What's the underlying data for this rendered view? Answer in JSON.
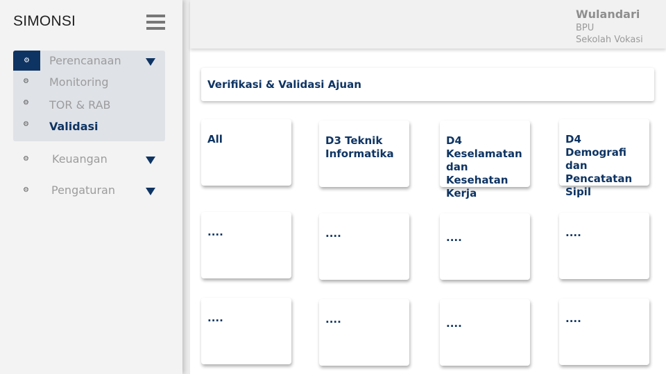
{
  "app": {
    "brand": "SIMONSI"
  },
  "sidebar": {
    "menu": [
      {
        "label": "Perencanaan",
        "icon": "menu-icon",
        "expanded": true,
        "items": [
          {
            "label": "Monitoring"
          },
          {
            "label": "TOR & RAB"
          },
          {
            "label": "Validasi",
            "active": true
          }
        ]
      },
      {
        "label": "Keuangan",
        "icon": "menu-icon",
        "expanded": false
      },
      {
        "label": "Pengaturan",
        "icon": "menu-icon",
        "expanded": false
      }
    ]
  },
  "header": {
    "user_name": "Wulandari",
    "user_role": "BPU",
    "user_unit": "Sekolah Vokasi"
  },
  "main": {
    "title": "Verifikasi & Validasi Ajuan",
    "cards": [
      {
        "label": "All"
      },
      {
        "label": "D3 Teknik Informatika"
      },
      {
        "label": "D4 Keselamatan dan Kesehatan Kerja"
      },
      {
        "label": "D4 Demografi dan Pencatatan Sipil"
      },
      {
        "label": "...."
      },
      {
        "label": "...."
      },
      {
        "label": "...."
      },
      {
        "label": "...."
      },
      {
        "label": "...."
      },
      {
        "label": "...."
      },
      {
        "label": "...."
      },
      {
        "label": "...."
      }
    ]
  },
  "colors": {
    "accent": "#0e3463",
    "muted_text": "#9c9c9c",
    "submenu_bg": "#dfe2e7"
  }
}
